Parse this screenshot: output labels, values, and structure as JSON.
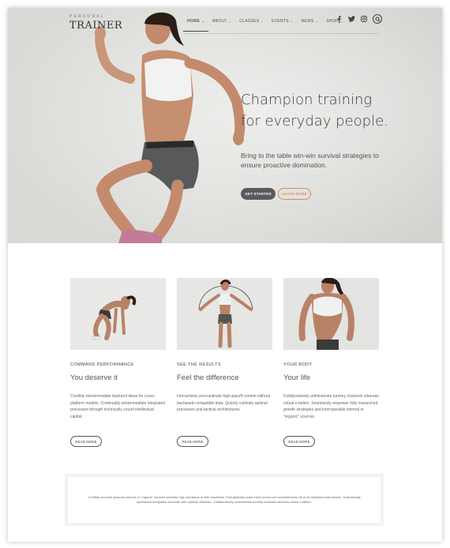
{
  "brand": {
    "small": "PERSONAL",
    "big": "TRAINER"
  },
  "nav": {
    "items": [
      {
        "label": "HOME",
        "caret": "⌄",
        "active": true
      },
      {
        "label": "ABOUT",
        "caret": "⌄"
      },
      {
        "label": "CLASSES",
        "caret": "⌄"
      },
      {
        "label": "EVENTS",
        "caret": "⌄"
      },
      {
        "label": "NEWS",
        "caret": "⌄"
      },
      {
        "label": "SHOP",
        "caret": "⌄"
      }
    ],
    "social": [
      "facebook-icon",
      "twitter-icon",
      "instagram-icon",
      "search-icon"
    ]
  },
  "hero": {
    "title_line1": "Champion training",
    "title_line2": "for everyday people.",
    "subtitle": "Bring to the table win-win survival strategies to ensure proactive domination.",
    "primary_button": "GET STARTED",
    "secondary_button": "LEARN MORE"
  },
  "features": [
    {
      "category": "COMMAND PERFORMANCE",
      "title": "You deserve it",
      "description": "Credibly reintermediate backend ideas for cross-platform models. Continually reintermediate integrated processes through technically sound intellectual capital.",
      "button": "READ MORE"
    },
    {
      "category": "SEE THE RESULTS",
      "title": "Feel the difference",
      "description": "Interactively procrastinate high-payoff content without backward-compatible data. Quickly cultivate optimal processes and tactical architectures.",
      "button": "READ MORE"
    },
    {
      "category": "YOUR BODY",
      "title": "Your life",
      "description": "Collaboratively administrate turnkey channels whereas virtual e-tailers. Seamlessly empower fully researched growth strategies and interoperable internal or \"organic\" sources.",
      "button": "READ MORE"
    }
  ],
  "note": {
    "text": "Credibly innovate granular internal or \"organic\" sources whereas high standards in web-readiness. Energistically scale future-proof core competencies vis-a-vis impactful experiences. Dramatically synthesize integrated schemas with optimal networks. Collaboratively administrate turnkey channels whereas virtual e-tailers."
  },
  "colors": {
    "accent": "#d0763a",
    "dark_button": "#5a5a5e"
  }
}
